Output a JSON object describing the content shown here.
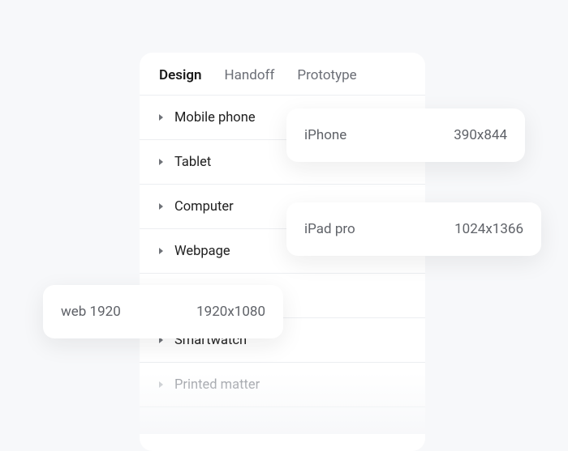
{
  "tabs": {
    "design": "Design",
    "handoff": "Handoff",
    "prototype": "Prototype"
  },
  "categories": {
    "mobile_phone": "Mobile phone",
    "tablet": "Tablet",
    "computer": "Computer",
    "webpage": "Webpage",
    "spacer": " ",
    "smartwatch": "Smartwatch",
    "printed_matter": "Printed matter"
  },
  "cards": {
    "iphone": {
      "name": "iPhone",
      "dim": "390x844"
    },
    "ipad": {
      "name": "iPad pro",
      "dim": "1024x1366"
    },
    "web": {
      "name": "web 1920",
      "dim": "1920x1080"
    }
  }
}
